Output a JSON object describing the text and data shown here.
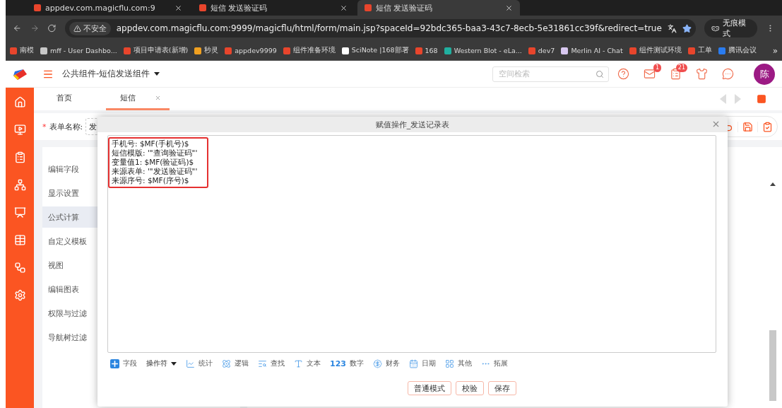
{
  "browser": {
    "tabs": [
      {
        "title": "appdev.com.magicflu.com:9",
        "selected": false
      },
      {
        "title": "短信 发送验证码",
        "selected": false
      },
      {
        "title": "短信 发送验证码",
        "selected": true
      }
    ],
    "address": {
      "security": "不安全",
      "url": "appdev.com.magicflu.com:9999/magicflu/html/form/main.jsp?spaceId=92bdc365-baa3-43c7-8ecb-5e31861cc39f&redirect=true"
    },
    "incognito": "无痕模式",
    "bookmarks": [
      {
        "label": "南模",
        "color": "#e8452c"
      },
      {
        "label": "mff - User Dashbo...",
        "color": "#c8c8c8"
      },
      {
        "label": "项目申请表(新增)",
        "color": "#e8452c"
      },
      {
        "label": "秒灵",
        "color": "#f0a020"
      },
      {
        "label": "appdev9999",
        "color": "#e8452c"
      },
      {
        "label": "组件准备环境",
        "color": "#e8452c"
      },
      {
        "label": "SciNote |168部署",
        "color": "#ffffff"
      },
      {
        "label": "168",
        "color": "#e8452c"
      },
      {
        "label": "Western Blot - eLa...",
        "color": "#20b0a0"
      },
      {
        "label": "dev7",
        "color": "#e8452c"
      },
      {
        "label": "Merlin AI - Chat",
        "color": "#d8c8f0"
      },
      {
        "label": "组件测试环境",
        "color": "#e8452c"
      },
      {
        "label": "工单",
        "color": "#e8452c"
      },
      {
        "label": "腾讯会议",
        "color": "#2a7cf0"
      }
    ],
    "bookmarks_more": "»"
  },
  "app": {
    "space": "公共组件-短信发送组件",
    "search": {
      "placeholder": "空间检索"
    },
    "header_icons": [
      {
        "kind": "help"
      },
      {
        "kind": "mail",
        "badge": "1"
      },
      {
        "kind": "tasks",
        "badge": "21"
      },
      {
        "kind": "skin"
      },
      {
        "kind": "more"
      }
    ],
    "avatar": "陈",
    "page_tabs": [
      {
        "label": "首页",
        "selected": false,
        "closable": false
      },
      {
        "label": "短信",
        "selected": true,
        "closable": true
      }
    ],
    "form_name": {
      "required_mark": "*",
      "label": "表单名称:",
      "value": "发"
    },
    "menu": [
      {
        "label": "编辑字段",
        "selected": false
      },
      {
        "label": "显示设置",
        "selected": false
      },
      {
        "label": "公式计算",
        "selected": true
      },
      {
        "label": "自定义模板",
        "selected": false
      },
      {
        "label": "视图",
        "selected": false
      },
      {
        "label": "编辑图表",
        "selected": false
      },
      {
        "label": "权限与过滤",
        "selected": false
      },
      {
        "label": "导航树过滤",
        "selected": false
      }
    ]
  },
  "dialog": {
    "title": "赋值操作_发送记录表",
    "formula": [
      "手机号: $MF(手机号)$",
      "短信模版: '\"查询验证码\"'",
      "变量值1: $MF(验证码)$",
      "来源表单: '\"发送验证码\"'",
      "来源序号: $MF(序号)$"
    ],
    "toolbar": [
      {
        "kind": "field",
        "label": "字段"
      },
      {
        "kind": "operator",
        "label": "操作符"
      },
      {
        "kind": "stats",
        "label": "统计"
      },
      {
        "kind": "logic",
        "label": "逻辑"
      },
      {
        "kind": "lookup",
        "label": "查找"
      },
      {
        "kind": "text",
        "label": "文本"
      },
      {
        "kind": "number",
        "glyph": "123",
        "label": "数字"
      },
      {
        "kind": "finance",
        "label": "财务"
      },
      {
        "kind": "date",
        "label": "日期"
      },
      {
        "kind": "other",
        "label": "其他"
      },
      {
        "kind": "extend",
        "label": "拓展"
      }
    ],
    "buttons": [
      "普通模式",
      "校验",
      "保存"
    ]
  }
}
